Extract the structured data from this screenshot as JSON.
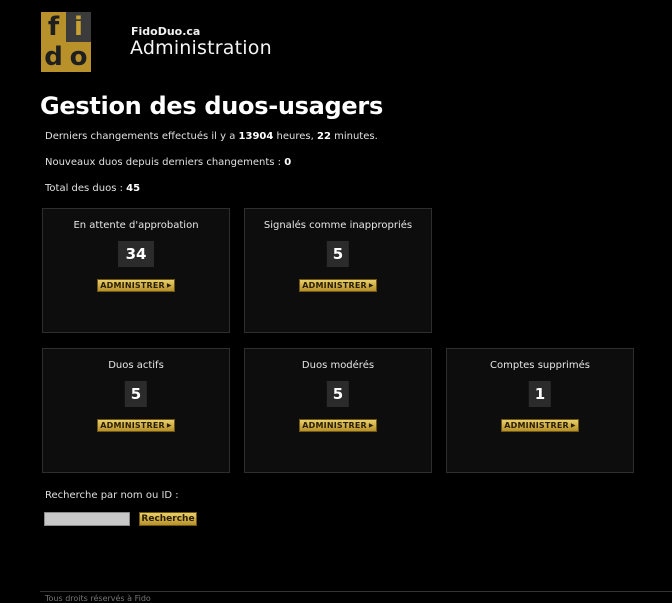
{
  "header": {
    "logo_letters": [
      "f",
      "i",
      "d",
      "o"
    ],
    "site_name": "FidoDuo.ca",
    "section": "Administration"
  },
  "page_title": "Gestion des duos-usagers",
  "info": {
    "last_changes_prefix": "Derniers changements effectués il y a",
    "hours": "13904",
    "hours_word": "heures,",
    "minutes": "22",
    "minutes_word": "minutes.",
    "new_duos_label": "Nouveaux duos depuis derniers changements :",
    "new_duos_value": "0",
    "total_label": "Total des duos :",
    "total_value": "45"
  },
  "panels": [
    {
      "title": "En attente d'approbation",
      "count": "34",
      "button": "ADMINISTRER"
    },
    {
      "title": "Signalés comme inappropriés",
      "count": "5",
      "button": "ADMINISTRER"
    },
    {
      "title": "Duos actifs",
      "count": "5",
      "button": "ADMINISTRER"
    },
    {
      "title": "Duos modérés",
      "count": "5",
      "button": "ADMINISTRER"
    },
    {
      "title": "Comptes supprimés",
      "count": "1",
      "button": "ADMINISTRER"
    }
  ],
  "search": {
    "label": "Recherche par nom ou ID :",
    "value": "",
    "button": "Recherche"
  },
  "footer": {
    "text": "Tous droits réservés à Fido"
  },
  "colors": {
    "background": "#000000",
    "gold": "#b8912a",
    "panel_bg": "#0d0d0d"
  }
}
